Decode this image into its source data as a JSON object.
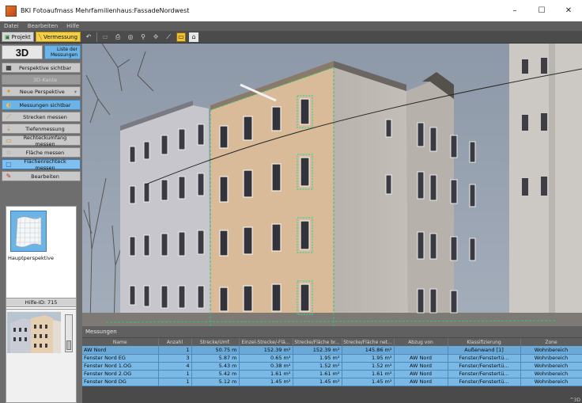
{
  "window": {
    "title": "BKI Fotoaufmass Mehrfamilienhaus:FassadeNordwest",
    "minimize": "–",
    "maximize": "☐",
    "close": "✕"
  },
  "menu": [
    "Datei",
    "Bearbeiten",
    "Hilfe"
  ],
  "toolbar": {
    "projekt_label": "Projekt",
    "vermessung_label": "Vermessung"
  },
  "left_panel": {
    "btn_3d": "3D",
    "btn_liste_line1": "Liste der",
    "btn_liste_line2": "Messungen",
    "buttons": [
      {
        "label": "Perspektive sichtbar"
      },
      {
        "label": "3D-Kante"
      },
      {
        "label": "Neue Perspektive"
      },
      {
        "label": "Messungen sichtbar"
      },
      {
        "label": "Strecken messen"
      },
      {
        "label": "Tiefenmessung"
      },
      {
        "label": "Rechteckumfang messen"
      },
      {
        "label": "Fläche messen"
      },
      {
        "label": "Flächenrechteck messen"
      },
      {
        "label": "Bearbeiten"
      }
    ],
    "perspective_label": "Hauptperspektive",
    "hilfe_label": "Hilfe-ID: 715"
  },
  "measurements": {
    "title": "Messungen",
    "columns": [
      "Name",
      "Anzahl",
      "Strecke/Umf.",
      "Einzel-Strecke/-Flä...",
      "Strecke/Fläche br...",
      "Strecke/Fläche net...",
      "Abzug von",
      "Klassifizierung",
      "Zone"
    ],
    "rows": [
      [
        "AW Nord",
        "1",
        "50.75 m",
        "152.39 m²",
        "152.39 m²",
        "145.86 m²",
        "",
        "Außenwand [1]",
        "Wohnbereich"
      ],
      [
        "Fenster Nord EG",
        "3",
        "5.87 m",
        "0.65 m²",
        "1.95 m²",
        "1.95 m²",
        "AW Nord",
        "Fenster/Fenstertü...",
        "Wohnbereich"
      ],
      [
        "Fenster Nord 1.OG",
        "4",
        "5.43 m",
        "0.38 m²",
        "1.52 m²",
        "1.52 m²",
        "AW Nord",
        "Fenster/Fenstertü...",
        "Wohnbereich"
      ],
      [
        "Fenster Nord 2.OG",
        "1",
        "5.42 m",
        "1.61 m²",
        "1.61 m²",
        "1.61 m²",
        "AW Nord",
        "Fenster/Fenstertü...",
        "Wohnbereich"
      ],
      [
        "Fenster Nord DG",
        "1",
        "5.12 m",
        "1.45 m²",
        "1.45 m²",
        "1.45 m²",
        "AW Nord",
        "Fenster/Fenstertü...",
        "Wohnbereich"
      ]
    ]
  },
  "status_corner": "​^3D"
}
